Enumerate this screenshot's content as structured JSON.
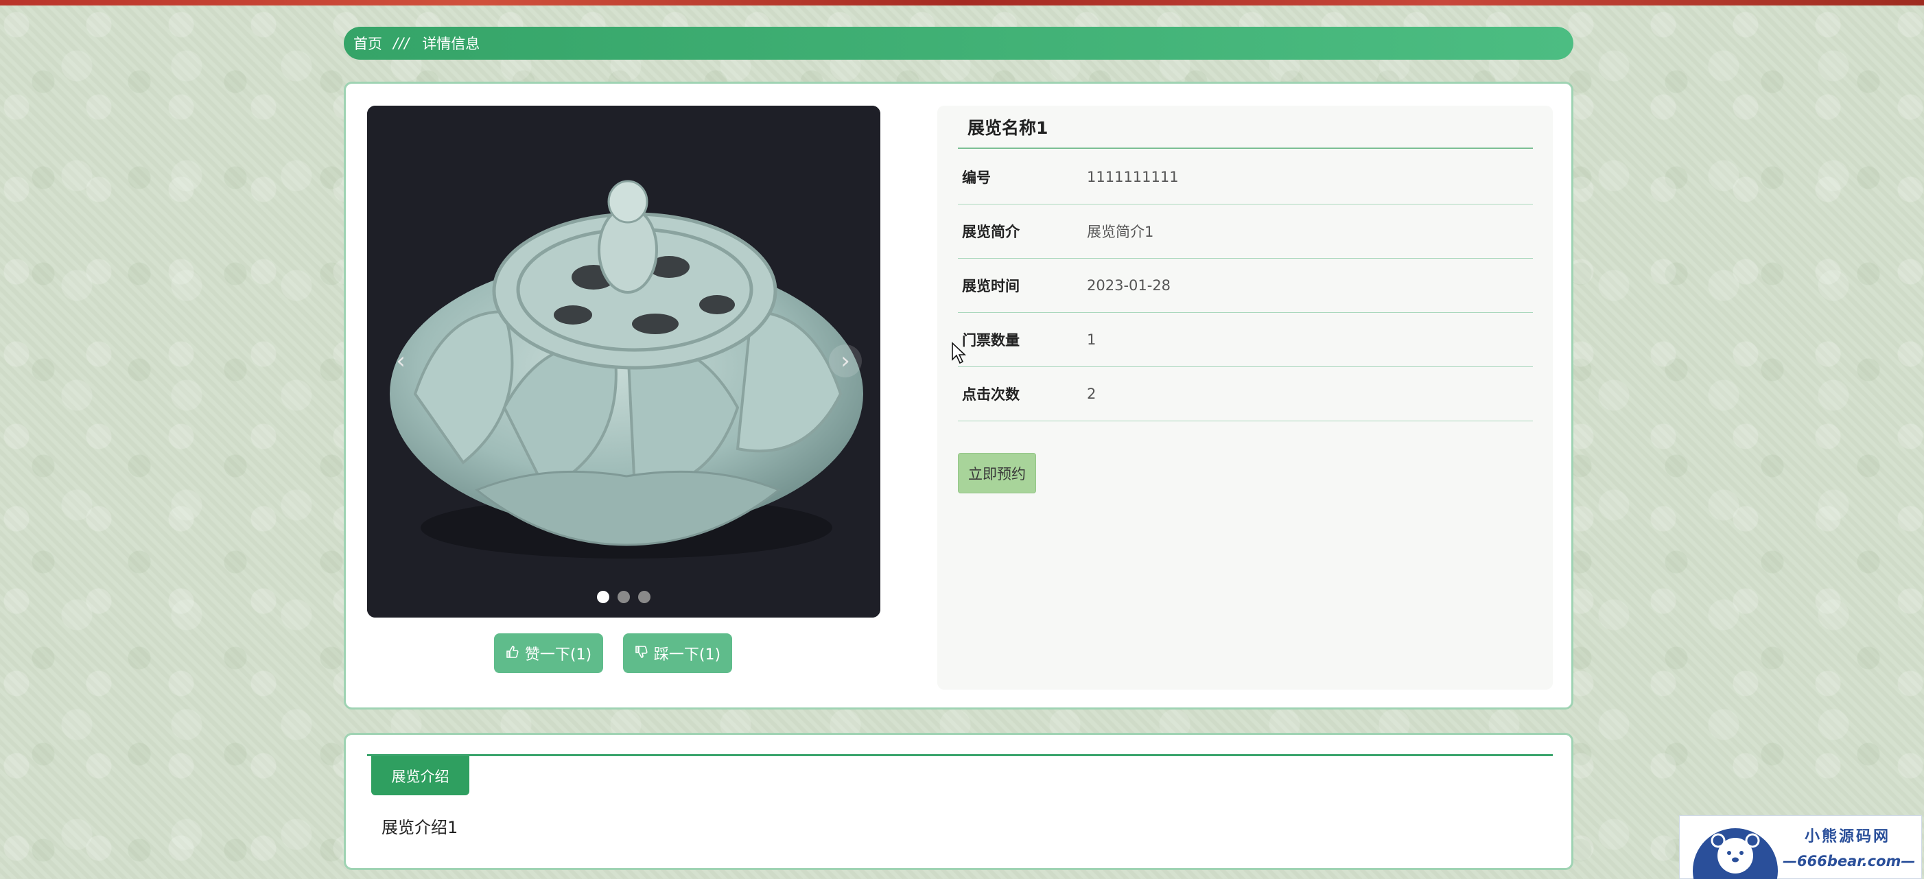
{
  "breadcrumb": {
    "home": "首页",
    "separator": "///",
    "current": "详情信息"
  },
  "gallery": {
    "prev": "‹",
    "next": "›",
    "slides": 3,
    "active_slide": 1
  },
  "actions": {
    "like_label": "赞一下(1)",
    "dislike_label": "踩一下(1)"
  },
  "detail": {
    "title": "展览名称1",
    "fields": [
      {
        "label": "编号",
        "value": "1111111111"
      },
      {
        "label": "展览简介",
        "value": "展览简介1"
      },
      {
        "label": "展览时间",
        "value": "2023-01-28"
      },
      {
        "label": "门票数量",
        "value": "1"
      },
      {
        "label": "点击次数",
        "value": "2"
      }
    ],
    "reserve_label": "立即预约"
  },
  "intro": {
    "tab_label": "展览介绍",
    "content": "展览介绍1"
  },
  "watermark": {
    "line1": "小熊源码网",
    "line2": "—666bear.com—"
  },
  "colors": {
    "accent": "#35a468",
    "button": "#5fbc8b",
    "reserve": "#a8d49a"
  }
}
